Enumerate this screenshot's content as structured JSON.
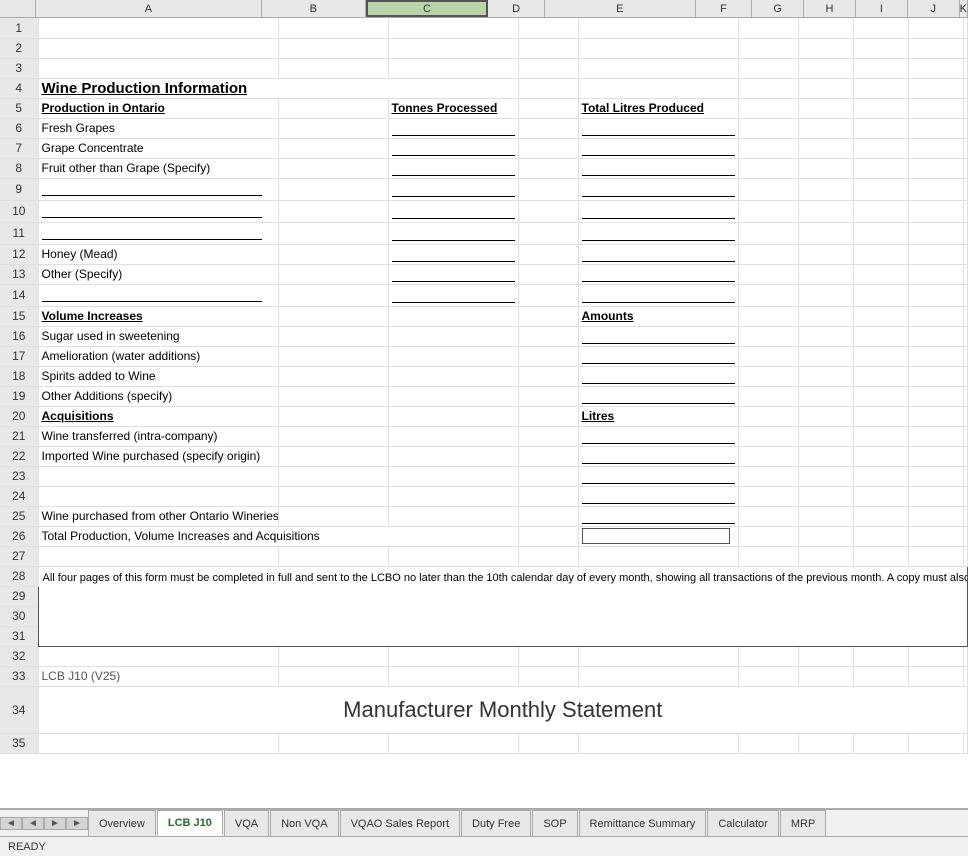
{
  "title": "Wine Production Information",
  "main_title": "Manufacturer Monthly Statement",
  "columns": {
    "row_header": "",
    "col_A": "A",
    "col_B": "B",
    "col_C": "C",
    "col_D": "D",
    "col_E": "E",
    "col_F": "F",
    "col_G": "G",
    "col_H": "H",
    "col_I": "I",
    "col_J": "J",
    "col_K": "K"
  },
  "rows": [
    {
      "num": "4",
      "content": "title",
      "text": "Wine Production Information"
    },
    {
      "num": "5",
      "content": "headers"
    },
    {
      "num": "6",
      "content": "data",
      "label": "Fresh Grapes"
    },
    {
      "num": "7",
      "content": "data",
      "label": "Grape Concentrate"
    },
    {
      "num": "8",
      "content": "data",
      "label": "Fruit other than Grape (Specify)"
    },
    {
      "num": "9",
      "content": "input"
    },
    {
      "num": "10",
      "content": "input"
    },
    {
      "num": "11",
      "content": "input"
    },
    {
      "num": "12",
      "content": "data",
      "label": "Honey (Mead)"
    },
    {
      "num": "13",
      "content": "data",
      "label": "Other (Specify)"
    },
    {
      "num": "14",
      "content": "input"
    },
    {
      "num": "15",
      "content": "section_header",
      "label": "Volume Increases",
      "col_f_label": "Amounts"
    },
    {
      "num": "16",
      "content": "data",
      "label": "Sugar used in sweetening"
    },
    {
      "num": "17",
      "content": "data",
      "label": "Amelioration (water additions)"
    },
    {
      "num": "18",
      "content": "data",
      "label": "Spirits added to Wine"
    },
    {
      "num": "19",
      "content": "data",
      "label": "Other Additions (specify)"
    },
    {
      "num": "20",
      "content": "section_header",
      "label": "Acquisitions",
      "col_f_label": "Litres"
    },
    {
      "num": "21",
      "content": "data",
      "label": "Wine transferred (intra-company)"
    },
    {
      "num": "22",
      "content": "data",
      "label": "Imported Wine purchased (specify origin)"
    },
    {
      "num": "23",
      "content": "input"
    },
    {
      "num": "24",
      "content": "input"
    },
    {
      "num": "25",
      "content": "data",
      "label": "Wine purchased from other Ontario Wineries"
    },
    {
      "num": "26",
      "content": "data",
      "label": "Total Production, Volume Increases and Acquisitions",
      "has_box": true
    },
    {
      "num": "27",
      "content": "empty"
    },
    {
      "num": "28-31",
      "content": "notice"
    },
    {
      "num": "32",
      "content": "empty"
    },
    {
      "num": "33",
      "content": "ref",
      "label": "LCB J10 (V25)"
    }
  ],
  "notice_text": "All four pages of this form must be completed in full and sent to the LCBO no later than the 10th calendar day of every month, showing all transactions of the previous month. A copy must also be retained by the Winery. Completed forms should be emailed to winery.reporting@lcbo.com or mailed to Finance Reception (Dept# 821), LCBO, 55 Lake Shore Blvd. East, M5E 1A4 or faxed to (416) 864-6855. This information is required under O.Reg. 717 s,16.",
  "col_d_header": "Tonnes Processed",
  "col_f_header": "Total Litres Produced",
  "col_b_header": "Production in Ontario",
  "tabs": [
    {
      "label": "Overview",
      "active": false
    },
    {
      "label": "LCB J10",
      "active": true
    },
    {
      "label": "VQA",
      "active": false
    },
    {
      "label": "Non VQA",
      "active": false
    },
    {
      "label": "VQAO Sales Report",
      "active": false
    },
    {
      "label": "Duty Free",
      "active": false
    },
    {
      "label": "SOP",
      "active": false
    },
    {
      "label": "Remittance Summary",
      "active": false
    },
    {
      "label": "Calculator",
      "active": false
    },
    {
      "label": "MRP",
      "active": false
    }
  ],
  "status": "READY"
}
